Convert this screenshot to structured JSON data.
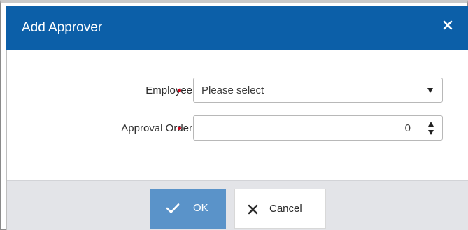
{
  "dialog": {
    "title": "Add Approver",
    "close_icon": "close-icon"
  },
  "form": {
    "employee": {
      "label": "Employee",
      "placeholder": "Please select",
      "required": true,
      "icon": "dropdown-caret-icon"
    },
    "approval_order": {
      "label": "Approval Order",
      "value": "0",
      "required": true,
      "icons": [
        "spin-up-icon",
        "spin-down-icon"
      ]
    }
  },
  "footer": {
    "ok_label": "OK",
    "ok_icon": "checkmark-icon",
    "cancel_label": "Cancel",
    "cancel_icon": "x-icon"
  },
  "colors": {
    "titlebar": "#0c5fa8",
    "ok_button": "#5a93c9",
    "required_dot": "#d0021b",
    "footer_bg": "#e3e4e8"
  }
}
